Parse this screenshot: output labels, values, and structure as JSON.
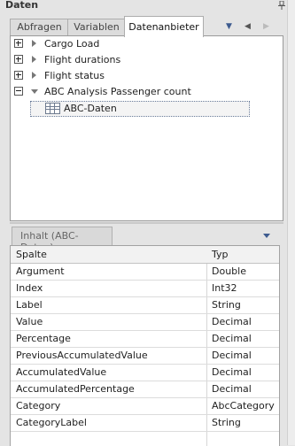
{
  "panel": {
    "title": "Daten",
    "pin_icon": "pin-icon"
  },
  "tabs": [
    {
      "label": "Abfragen"
    },
    {
      "label": "Variablen"
    },
    {
      "label": "Datenanbieter"
    }
  ],
  "tab_controls": {
    "dropdown_icon": "triangle-down-icon",
    "prev_icon": "triangle-left-icon",
    "next_icon": "triangle-right-icon"
  },
  "tree": {
    "items": [
      {
        "label": "Cargo Load",
        "expanded": false
      },
      {
        "label": "Flight durations",
        "expanded": false
      },
      {
        "label": "Flight status",
        "expanded": false
      },
      {
        "label": "ABC Analysis Passenger count",
        "expanded": true
      }
    ],
    "child": {
      "label": "ABC-Daten",
      "icon": "table-icon"
    }
  },
  "content": {
    "tab_label": "Inhalt (ABC-Daten)",
    "columns": [
      "Spalte",
      "Typ"
    ],
    "rows": [
      {
        "name": "Argument",
        "type": "Double"
      },
      {
        "name": "Index",
        "type": "Int32"
      },
      {
        "name": "Label",
        "type": "String"
      },
      {
        "name": "Value",
        "type": "Decimal"
      },
      {
        "name": "Percentage",
        "type": "Decimal"
      },
      {
        "name": "PreviousAccumulatedValue",
        "type": "Decimal"
      },
      {
        "name": "AccumulatedValue",
        "type": "Decimal"
      },
      {
        "name": "AccumulatedPercentage",
        "type": "Decimal"
      },
      {
        "name": "Category",
        "type": "AbcCategory"
      },
      {
        "name": "CategoryLabel",
        "type": "String"
      }
    ]
  },
  "colors": {
    "accent": "#3d5b8f",
    "background": "#e4e4e4",
    "border": "#9a9a9a"
  }
}
